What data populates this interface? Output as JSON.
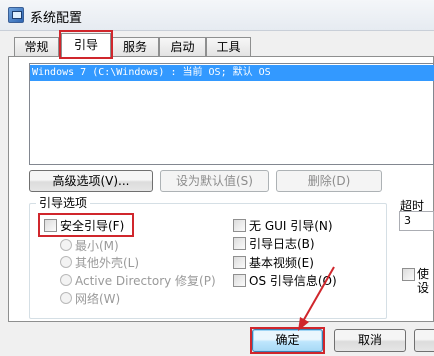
{
  "window": {
    "title": "系统配置",
    "icon": "msconfig-icon"
  },
  "tabs": [
    {
      "label": "常规",
      "active": false
    },
    {
      "label": "引导",
      "active": true
    },
    {
      "label": "服务",
      "active": false
    },
    {
      "label": "启动",
      "active": false
    },
    {
      "label": "工具",
      "active": false
    }
  ],
  "os_list": {
    "items": [
      "Windows 7 (C:\\Windows) : 当前 OS; 默认 OS"
    ],
    "selected_index": 0
  },
  "list_buttons": {
    "advanced": "高级选项(V)...",
    "set_default": "设为默认值(S)",
    "delete": "删除(D)"
  },
  "boot_options": {
    "group_label": "引导选项",
    "safe_boot": {
      "label": "安全引导(F)",
      "checked": false
    },
    "safe_modes": [
      "最小(M)",
      "其他外壳(L)",
      "Active Directory 修复(P)",
      "网络(W)"
    ],
    "right_options": [
      {
        "label": "无 GUI 引导(N)",
        "checked": false
      },
      {
        "label": "引导日志(B)",
        "checked": false
      },
      {
        "label": "基本视频(E)",
        "checked": false
      },
      {
        "label": "OS 引导信息(O)",
        "checked": false
      }
    ]
  },
  "timeout": {
    "label": "超时(T):",
    "value": "3"
  },
  "persist": {
    "label_line1": "使",
    "label_line2": "设"
  },
  "footer": {
    "ok": "确定",
    "cancel": "取消"
  },
  "annotations": {
    "highlight_color": "#d0262c"
  }
}
